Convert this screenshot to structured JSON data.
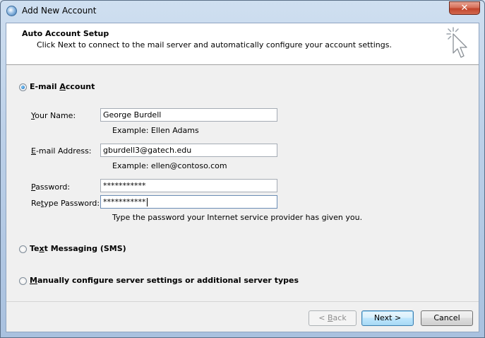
{
  "window": {
    "title": "Add New Account",
    "close_label": "✕"
  },
  "header": {
    "title": "Auto Account Setup",
    "subtitle": "Click Next to connect to the mail server and automatically configure your account settings."
  },
  "options": {
    "email": {
      "pre": "E-mail ",
      "accel": "A",
      "post": "ccount",
      "selected": true
    },
    "sms": {
      "pre": "Te",
      "accel": "x",
      "post": "t Messaging (SMS)",
      "selected": false
    },
    "manual": {
      "pre": "",
      "accel": "M",
      "post": "anually configure server settings or additional server types",
      "selected": false
    }
  },
  "form": {
    "name": {
      "label_accel": "Y",
      "label_rest": "our Name:",
      "value": "George Burdell",
      "example": "Example: Ellen Adams"
    },
    "email": {
      "label_pre": "",
      "label_accel": "E",
      "label_rest": "-mail Address:",
      "value": "gburdell3@gatech.edu",
      "example": "Example: ellen@contoso.com"
    },
    "password": {
      "label_accel": "P",
      "label_rest": "assword:",
      "value": "***********"
    },
    "retype": {
      "label_pre": "Re",
      "label_accel": "t",
      "label_rest": "ype Password:",
      "value": "***********",
      "hint": "Type the password your Internet service provider has given you."
    }
  },
  "buttons": {
    "back": {
      "pre": "< ",
      "accel": "B",
      "post": "ack",
      "enabled": false
    },
    "next": {
      "label": "Next >"
    },
    "cancel": {
      "label": "Cancel"
    }
  }
}
